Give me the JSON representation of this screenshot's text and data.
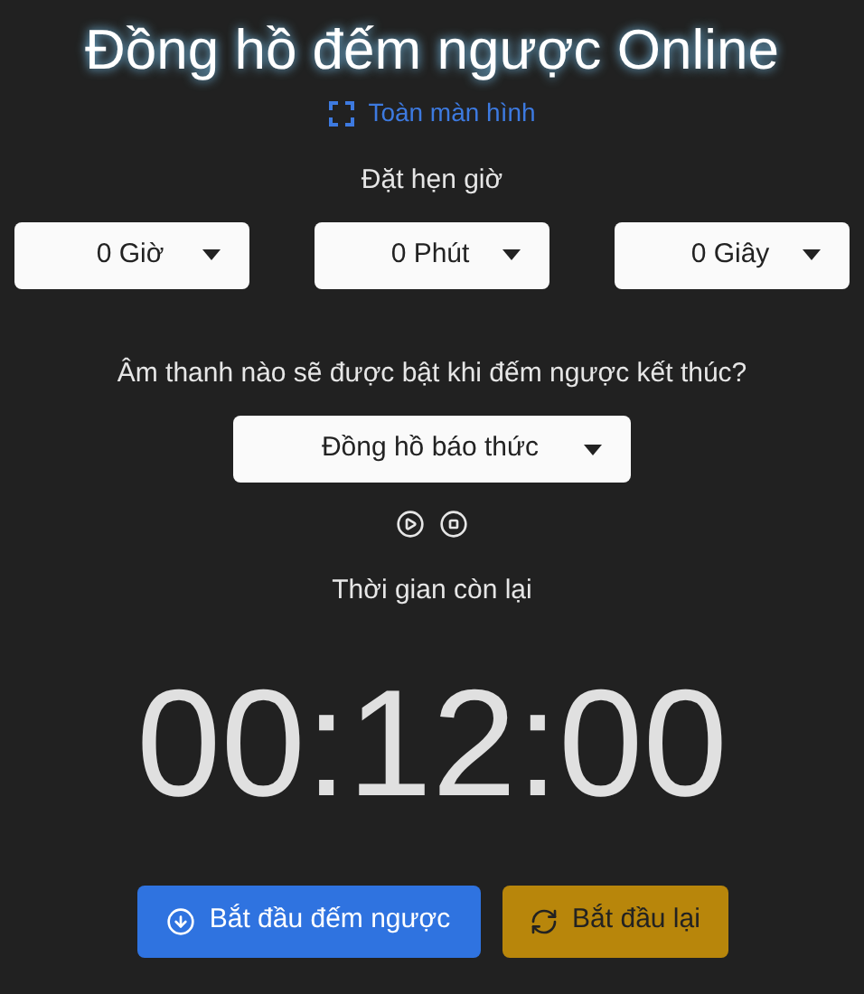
{
  "title": "Đồng hồ đếm ngược Online",
  "fullscreen_link": "Toàn màn hình",
  "set_timer_label": "Đặt hẹn giờ",
  "time_selects": [
    {
      "value": "0 Giờ"
    },
    {
      "value": "0 Phút"
    },
    {
      "value": "0 Giây"
    }
  ],
  "sound_question": "Âm thanh nào sẽ được bật khi đếm ngược kết thúc?",
  "sound_select": {
    "value": "Đồng hồ báo thức"
  },
  "remaining_label": "Thời gian còn lại",
  "timer": "00:12:00",
  "buttons": [
    {
      "kind": "start",
      "label": "Bắt đầu đếm ngược"
    },
    {
      "kind": "reset",
      "label": "Bắt đầu lại"
    }
  ]
}
